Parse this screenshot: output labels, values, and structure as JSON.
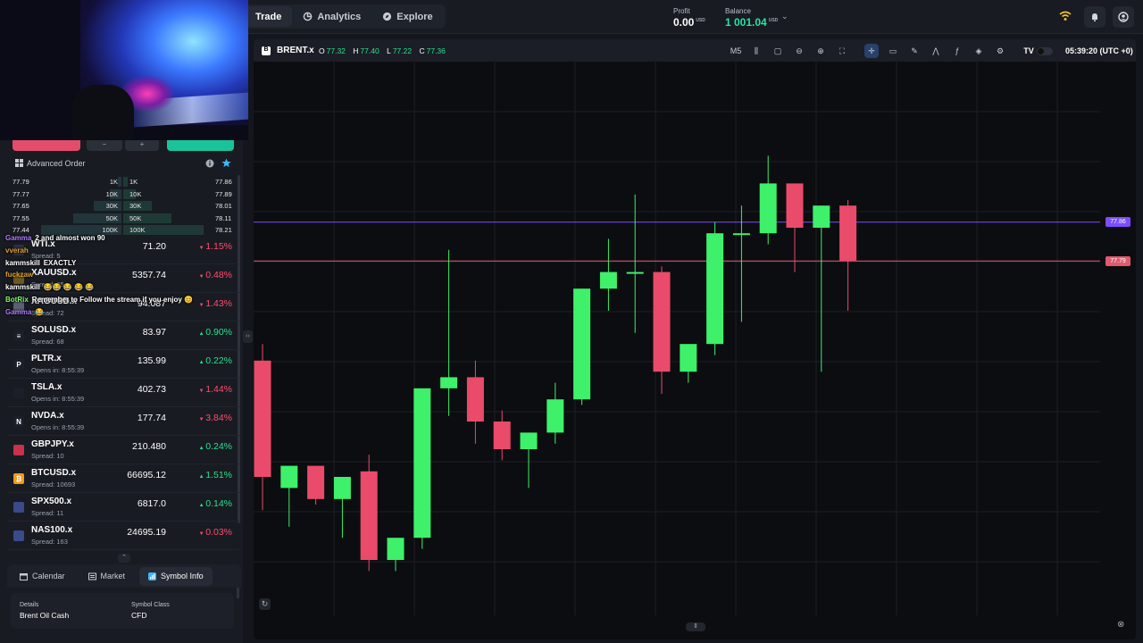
{
  "nav": {
    "trade": "Trade",
    "analytics": "Analytics",
    "explore": "Explore"
  },
  "account": {
    "profit_label": "Profit",
    "profit_value": "0.00",
    "balance_label": "Balance",
    "balance_value": "1 001.04",
    "currency": "USD"
  },
  "advanced_order": "Advanced Order",
  "order_book": [
    {
      "bid": "77.79",
      "bid_size": "1K",
      "ask_size": "1K",
      "ask": "77.86",
      "bid_depth": 0.05,
      "ask_depth": 0.05
    },
    {
      "bid": "77.77",
      "bid_size": "10K",
      "ask_size": "10K",
      "ask": "77.89",
      "bid_depth": 0.15,
      "ask_depth": 0.15
    },
    {
      "bid": "77.65",
      "bid_size": "30K",
      "ask_size": "30K",
      "ask": "78.01",
      "bid_depth": 0.35,
      "ask_depth": 0.35
    },
    {
      "bid": "77.55",
      "bid_size": "50K",
      "ask_size": "50K",
      "ask": "78.11",
      "bid_depth": 0.6,
      "ask_depth": 0.6
    },
    {
      "bid": "77.44",
      "bid_size": "100K",
      "ask_size": "100K",
      "ask": "78.21",
      "bid_depth": 1.0,
      "ask_depth": 1.0
    }
  ],
  "chat": [
    {
      "user": "Gamma",
      "color": "#b17bff",
      "msg": "2 and almost won 90"
    },
    {
      "user": "vverah",
      "color": "#e0a030",
      "msg": ""
    },
    {
      "user": "kammskill",
      "color": "#ffffff",
      "msg": "EXACTLY"
    },
    {
      "user": "fuckzaw",
      "color": "#e0a030",
      "msg": ""
    },
    {
      "user": "kammskill",
      "color": "#ffffff",
      "msg": "😂😂 😂 😂 😂"
    },
    {
      "user": "BotRix",
      "color": "#7cff6b",
      "msg": "Remember to Follow the stream if you enjoy 😊"
    },
    {
      "user": "Gamma",
      "color": "#b17bff",
      "msg": "😂"
    }
  ],
  "watchlist": [
    {
      "symbol": "WTI.x",
      "sub": "Spread: 5",
      "price": "71.20",
      "change": "1.15%",
      "dir": "dn",
      "icon": "oil-drop",
      "icon_color": "#2b3040",
      "icon_glyph": ""
    },
    {
      "symbol": "XAUUSD.x",
      "sub": "Spread: 35",
      "price": "5357.74",
      "change": "0.48%",
      "dir": "dn",
      "icon": "gold",
      "icon_color": "#6b5a20",
      "icon_glyph": ""
    },
    {
      "symbol": "XAGUSD.x",
      "sub": "Spread: 72",
      "price": "94.087",
      "change": "1.43%",
      "dir": "dn",
      "icon": "silver",
      "icon_color": "#5a6070",
      "icon_glyph": ""
    },
    {
      "symbol": "SOLUSD.x",
      "sub": "Spread: 68",
      "price": "83.97",
      "change": "0.90%",
      "dir": "up",
      "icon": "solana",
      "icon_color": "#1b1f2a",
      "icon_glyph": "≡"
    },
    {
      "symbol": "PLTR.x",
      "sub": "Opens in: 8:55:39",
      "price": "135.99",
      "change": "0.22%",
      "dir": "up",
      "icon": "palantir",
      "icon_color": "#1b1f2a",
      "icon_glyph": "P"
    },
    {
      "symbol": "TSLA.x",
      "sub": "Opens in: 8:55:39",
      "price": "402.73",
      "change": "1.44%",
      "dir": "dn",
      "icon": "tesla",
      "icon_color": "#1b1f2a",
      "icon_glyph": ""
    },
    {
      "symbol": "NVDA.x",
      "sub": "Opens in: 8:55:39",
      "price": "177.74",
      "change": "3.84%",
      "dir": "dn",
      "icon": "nvidia",
      "icon_color": "#1b1f2a",
      "icon_glyph": "N"
    },
    {
      "symbol": "GBPJPY.x",
      "sub": "Spread: 10",
      "price": "210.480",
      "change": "0.24%",
      "dir": "up",
      "icon": "flag-gb",
      "icon_color": "#c8324a",
      "icon_glyph": ""
    },
    {
      "symbol": "BTCUSD.x",
      "sub": "Spread: 10693",
      "price": "66695.12",
      "change": "1.51%",
      "dir": "up",
      "icon": "bitcoin",
      "icon_color": "#f39a1c",
      "icon_glyph": "₿"
    },
    {
      "symbol": "SPX500.x",
      "sub": "Spread: 11",
      "price": "6817.0",
      "change": "0.14%",
      "dir": "up",
      "icon": "flag-us",
      "icon_color": "#3b4a8a",
      "icon_glyph": ""
    },
    {
      "symbol": "NAS100.x",
      "sub": "Spread: 163",
      "price": "24695.19",
      "change": "0.03%",
      "dir": "dn",
      "icon": "flag-us",
      "icon_color": "#3b4a8a",
      "icon_glyph": ""
    }
  ],
  "bottom_tabs": {
    "calendar": "Calendar",
    "market": "Market",
    "symbol_info": "Symbol Info"
  },
  "details": {
    "details_label": "Details",
    "details_value": "Brent Oil Cash",
    "class_label": "Symbol Class",
    "class_value": "CFD"
  },
  "chart_header": {
    "symbol": "BRENT.x",
    "o_label": "O",
    "o": "77.32",
    "h_label": "H",
    "h": "77.40",
    "l_label": "L",
    "l": "77.22",
    "c_label": "C",
    "c": "77.36",
    "timeframe": "M5",
    "time": "05:39:20 (UTC +0)"
  },
  "chart_data": {
    "type": "candlestick",
    "up_color": "#3ef06a",
    "down_color": "#ea4b6a",
    "ylim": [
      77.15,
      78.15
    ],
    "ask_line": {
      "value": 77.86,
      "label": "77.86",
      "color": "#7b4dff"
    },
    "bid_line": {
      "value": 77.79,
      "label": "77.79",
      "color": "#e05a6e"
    },
    "candles": [
      {
        "o": 77.61,
        "h": 77.64,
        "l": 77.34,
        "c": 77.4
      },
      {
        "o": 77.38,
        "h": 77.41,
        "l": 77.31,
        "c": 77.42
      },
      {
        "o": 77.42,
        "h": 77.42,
        "l": 77.35,
        "c": 77.36
      },
      {
        "o": 77.36,
        "h": 77.4,
        "l": 77.29,
        "c": 77.4
      },
      {
        "o": 77.41,
        "h": 77.44,
        "l": 77.23,
        "c": 77.25
      },
      {
        "o": 77.25,
        "h": 77.28,
        "l": 77.23,
        "c": 77.29
      },
      {
        "o": 77.29,
        "h": 77.55,
        "l": 77.27,
        "c": 77.56
      },
      {
        "o": 77.56,
        "h": 77.81,
        "l": 77.51,
        "c": 77.58
      },
      {
        "o": 77.58,
        "h": 77.61,
        "l": 77.46,
        "c": 77.5
      },
      {
        "o": 77.5,
        "h": 77.52,
        "l": 77.43,
        "c": 77.45
      },
      {
        "o": 77.45,
        "h": 77.48,
        "l": 77.38,
        "c": 77.48
      },
      {
        "o": 77.48,
        "h": 77.57,
        "l": 77.46,
        "c": 77.54
      },
      {
        "o": 77.54,
        "h": 77.74,
        "l": 77.53,
        "c": 77.74
      },
      {
        "o": 77.74,
        "h": 77.83,
        "l": 77.7,
        "c": 77.77
      },
      {
        "o": 77.77,
        "h": 77.91,
        "l": 77.66,
        "c": 77.77
      },
      {
        "o": 77.77,
        "h": 77.78,
        "l": 77.55,
        "c": 77.59
      },
      {
        "o": 77.59,
        "h": 77.64,
        "l": 77.57,
        "c": 77.64
      },
      {
        "o": 77.64,
        "h": 77.86,
        "l": 77.62,
        "c": 77.84
      },
      {
        "o": 77.84,
        "h": 77.89,
        "l": 77.68,
        "c": 77.84
      },
      {
        "o": 77.84,
        "h": 77.98,
        "l": 77.82,
        "c": 77.93
      },
      {
        "o": 77.93,
        "h": 77.93,
        "l": 77.77,
        "c": 77.85
      },
      {
        "o": 77.85,
        "h": 77.89,
        "l": 77.59,
        "c": 77.89
      },
      {
        "o": 77.89,
        "h": 77.9,
        "l": 77.7,
        "c": 77.79
      }
    ]
  }
}
